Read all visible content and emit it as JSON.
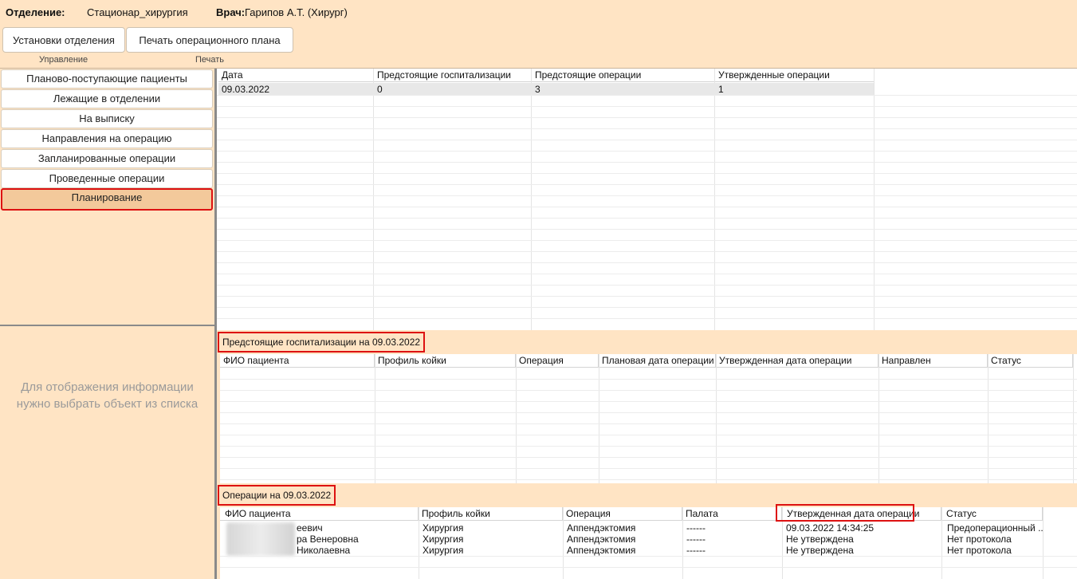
{
  "header": {
    "department_label": "Отделение:",
    "department_value": "Стационар_хирургия",
    "doctor_label": "Врач:",
    "doctor_value": "Гарипов А.Т. (Хирург)",
    "buttons": {
      "settings": "Установки отделения",
      "print_plan": "Печать операционного плана"
    },
    "groups": {
      "management": "Управление",
      "print": "Печать"
    }
  },
  "nav": {
    "items": [
      "Планово-поступающие пациенты",
      "Лежащие в отделении",
      "На выписку",
      "Направления на операцию",
      "Запланированные операции",
      "Проведенные операции",
      "Планирование"
    ],
    "active_index": 6
  },
  "placeholder": {
    "line1": "Для отображения информации",
    "line2": "нужно выбрать объект из списка"
  },
  "summary_grid": {
    "columns": [
      "Дата",
      "Предстоящие госпитализации",
      "Предстоящие операции",
      "Утвержденные операции"
    ],
    "rows": [
      [
        "09.03.2022",
        "0",
        "3",
        "1"
      ]
    ]
  },
  "hospitalizations": {
    "title": "Предстоящие госпитализации на 09.03.2022",
    "columns": [
      "ФИО пациента",
      "Профиль койки",
      "Операция",
      "Плановая дата операции",
      "Утвержденная дата операции",
      "Направлен",
      "Статус"
    ]
  },
  "operations": {
    "title": "Операции на 09.03.2022",
    "columns": [
      "ФИО пациента",
      "Профиль койки",
      "Операция",
      "Палата",
      "Утвержденная дата операции",
      "Статус"
    ],
    "rows": [
      [
        "еевич",
        "Хирургия",
        "Аппендэктомия",
        "------",
        "09.03.2022 14:34:25",
        "Предоперационный ..."
      ],
      [
        "ра Венеровна",
        "Хирургия",
        "Аппендэктомия",
        "------",
        "Не утверждена",
        "Нет протокола"
      ],
      [
        "Николаевна",
        "Хирургия",
        "Аппендэктомия",
        "------",
        "Не утверждена",
        "Нет протокола"
      ]
    ]
  }
}
